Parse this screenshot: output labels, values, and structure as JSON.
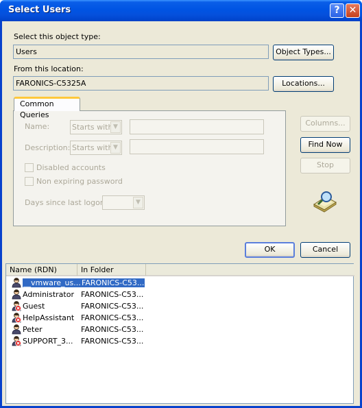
{
  "window": {
    "title": "Select Users",
    "help_glyph": "?",
    "close_glyph": "✕"
  },
  "object_type": {
    "label": "Select this object type:",
    "value": "Users",
    "button": "Object Types..."
  },
  "location": {
    "label": "From this location:",
    "value": "FARONICS-C5325A",
    "button": "Locations..."
  },
  "queries": {
    "tab_label": "Common Queries",
    "name_label": "Name:",
    "name_mode": "Starts with",
    "description_label": "Description:",
    "description_mode": "Starts with",
    "disabled_accounts": "Disabled accounts",
    "non_expiring": "Non expiring password",
    "days_label": "Days since last logon:"
  },
  "side_buttons": {
    "columns": "Columns...",
    "find_now": "Find Now",
    "stop": "Stop"
  },
  "dialog_buttons": {
    "ok": "OK",
    "cancel": "Cancel"
  },
  "results": {
    "columns": [
      "Name (RDN)",
      "In Folder"
    ],
    "rows": [
      {
        "name": "__vmware_us...",
        "folder": "FARONICS-C53...",
        "selected": true,
        "disabled": false
      },
      {
        "name": "Administrator",
        "folder": "FARONICS-C53...",
        "selected": false,
        "disabled": false
      },
      {
        "name": "Guest",
        "folder": "FARONICS-C53...",
        "selected": false,
        "disabled": true
      },
      {
        "name": "HelpAssistant",
        "folder": "FARONICS-C53...",
        "selected": false,
        "disabled": true
      },
      {
        "name": "Peter",
        "folder": "FARONICS-C53...",
        "selected": false,
        "disabled": false
      },
      {
        "name": "SUPPORT_3...",
        "folder": "FARONICS-C53...",
        "selected": false,
        "disabled": true
      }
    ]
  },
  "colors": {
    "titlebar": "#0054e3",
    "selection": "#316ac5",
    "dialog_bg": "#ece9d8"
  }
}
